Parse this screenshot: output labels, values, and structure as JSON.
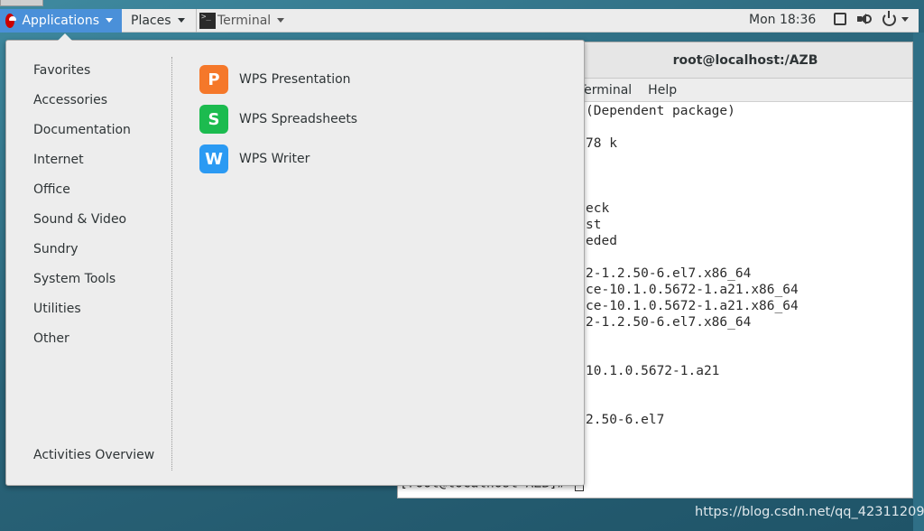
{
  "topbar": {
    "applications_label": "Applications",
    "places_label": "Places",
    "terminal_label": "Terminal",
    "clock": "Mon 18:36"
  },
  "terminal": {
    "title": "root@localhost:/AZB",
    "menu": [
      "Terminal",
      "Help"
    ],
    "lines": [
      "(Dependent package)",
      "",
      "78 k",
      "",
      "",
      "",
      "eck",
      "st",
      "eded",
      "",
      "2-1.2.50-6.el7.x86_64",
      "ce-10.1.0.5672-1.a21.x86_64",
      "ce-10.1.0.5672-1.a21.x86_64",
      "2-1.2.50-6.el7.x86_64",
      "",
      "",
      "10.1.0.5672-1.a21",
      "",
      "",
      "2.50-6.el7"
    ],
    "prompt": "[root@localhost AZB]# "
  },
  "app_menu": {
    "categories": [
      "Favorites",
      "Accessories",
      "Documentation",
      "Internet",
      "Office",
      "Sound & Video",
      "Sundry",
      "System Tools",
      "Utilities",
      "Other"
    ],
    "activities_label": "Activities Overview",
    "apps": [
      {
        "name": "WPS Presentation",
        "icon": "wps-presentation-icon",
        "glyph": "P",
        "color": "#f5782a"
      },
      {
        "name": "WPS Spreadsheets",
        "icon": "wps-spreadsheets-icon",
        "glyph": "S",
        "color": "#1cbb4f"
      },
      {
        "name": "WPS Writer",
        "icon": "wps-writer-icon",
        "glyph": "W",
        "color": "#2b9af3"
      }
    ]
  },
  "watermark": "https://blog.csdn.net/qq_42311209"
}
